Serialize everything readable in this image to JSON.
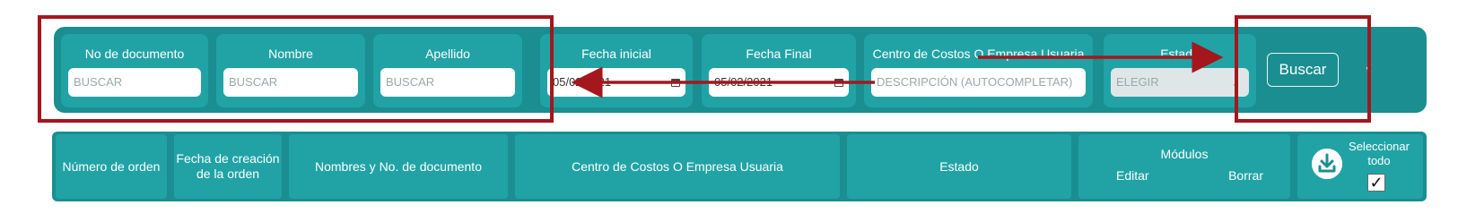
{
  "filters": {
    "doc_number": {
      "label": "No de documento",
      "placeholder": "BUSCAR"
    },
    "name": {
      "label": "Nombre",
      "placeholder": "BUSCAR"
    },
    "surname": {
      "label": "Apellido",
      "placeholder": "BUSCAR"
    },
    "start_date": {
      "label": "Fecha inicial",
      "value": "05/02/2021"
    },
    "end_date": {
      "label": "Fecha Final",
      "value": "05/02/2021"
    },
    "cost_center": {
      "label": "Centro de Costos O Empresa Usuaria",
      "placeholder": "DESCRIPCIÓN (AUTOCOMPLETAR)"
    },
    "status": {
      "label": "Estado",
      "placeholder": "ELEGIR"
    },
    "search_button": "Buscar",
    "collapse_icon": "chevron-left-icon"
  },
  "table_header": {
    "order_number": "Número de orden",
    "creation_date": "Fecha de creación de la orden",
    "names_doc": "Nombres y No. de documento",
    "cost_center": "Centro de Costos O Empresa Usuaria",
    "status": "Estado",
    "modules": "Módulos",
    "edit": "Editar",
    "delete": "Borrar",
    "select_all": "Seleccionar todo",
    "download_icon": "download-icon",
    "select_all_checked": true
  },
  "colors": {
    "bar": "#1a8e91",
    "cell": "#21a3a6",
    "annotation": "#a3171d"
  }
}
